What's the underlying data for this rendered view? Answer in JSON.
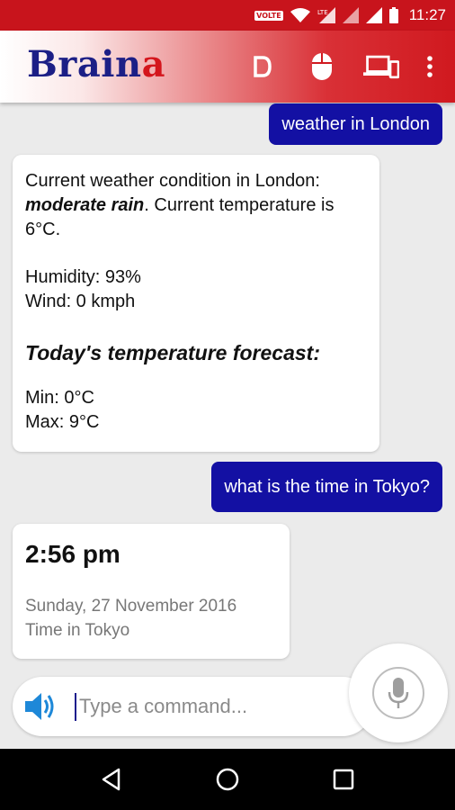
{
  "status_bar": {
    "volte": "VOLTE",
    "time": "11:27"
  },
  "app_bar": {
    "logo_main": "Brain",
    "logo_accent": "a",
    "actions": [
      "d-icon",
      "mouse-icon",
      "devices-icon",
      "more-vert-icon"
    ]
  },
  "messages": {
    "user_1": "weather in London",
    "weather_card": {
      "line_prefix": "Current weather condition in London: ",
      "condition": "moderate rain",
      "line_suffix": ". Current temperature is 6°C.",
      "humidity": "Humidity: 93%",
      "wind": "Wind: 0 kmph",
      "forecast_heading": "Today's temperature forecast:",
      "min": "Min: 0°C",
      "max": "Max: 9°C"
    },
    "user_2": "what is the time in Tokyo?",
    "time_card": {
      "time": "2:56 pm",
      "date": "Sunday, 27 November 2016",
      "label": "Time in Tokyo"
    }
  },
  "input": {
    "placeholder": "Type a command..."
  },
  "colors": {
    "status_bar": "#c8141c",
    "logo_blue": "#1c1f86",
    "logo_red": "#d4151c",
    "user_bubble": "#1310a3",
    "speaker_blue": "#1e88d8",
    "background": "#ebebeb"
  },
  "nav": [
    "back-icon",
    "home-icon",
    "recents-icon"
  ]
}
